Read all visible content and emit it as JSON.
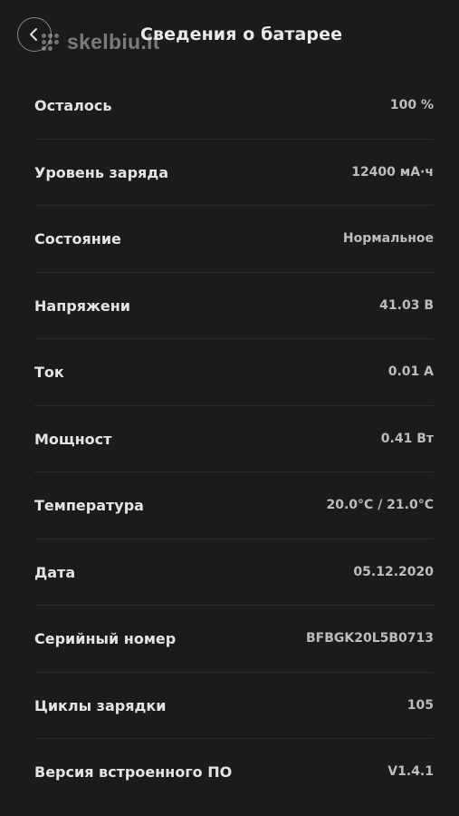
{
  "header": {
    "title": "Сведения о батарее",
    "back_icon": "chevron-left-icon",
    "watermark_text": "skelbiu.lt"
  },
  "rows": [
    {
      "label": "Осталось",
      "value": "100 %"
    },
    {
      "label": "Уровень заряда",
      "value": "12400 мА·ч"
    },
    {
      "label": "Состояние",
      "value": "Нормальное"
    },
    {
      "label": "Напряжени",
      "value": "41.03 В"
    },
    {
      "label": "Ток",
      "value": "0.01 А"
    },
    {
      "label": "Мощност",
      "value": "0.41 Вт"
    },
    {
      "label": "Температура",
      "value": "20.0°C / 21.0°C"
    },
    {
      "label": "Дата",
      "value": "05.12.2020"
    },
    {
      "label": "Серийный номер",
      "value": "BFBGK20L5B0713"
    },
    {
      "label": "Циклы зарядки",
      "value": "105"
    },
    {
      "label": "Версия встроенного ПО",
      "value": "V1.4.1"
    }
  ],
  "colors": {
    "background": "#1b1b1b",
    "label": "#e4e4e4",
    "value": "#bdbdbd",
    "divider": "#2a2a2a"
  }
}
